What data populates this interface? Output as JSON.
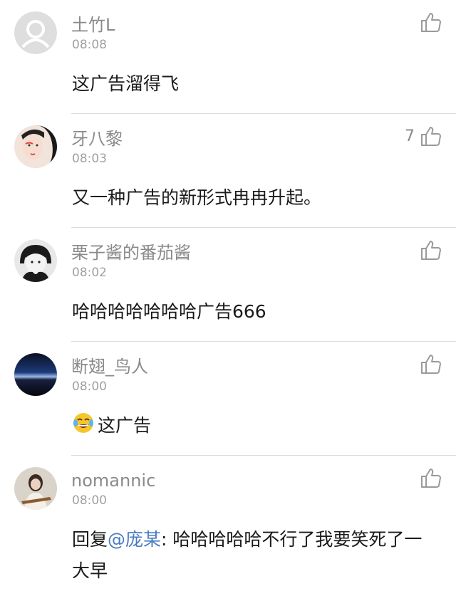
{
  "comments": [
    {
      "username": "土竹L",
      "time": "08:08",
      "text": "这广告溜得飞",
      "likes": "",
      "avatar_icon": "default-avatar-icon"
    },
    {
      "username": "牙八黎",
      "time": "08:03",
      "text": "又一种广告的新形式冉冉升起。",
      "likes": "7",
      "avatar_icon": "user-photo-avatar"
    },
    {
      "username": "栗子酱的番茄酱",
      "time": "08:02",
      "text": "哈哈哈哈哈哈哈广告666",
      "likes": "",
      "avatar_icon": "user-photo-avatar"
    },
    {
      "username": "断翅_鸟人",
      "time": "08:00",
      "text": "这广告",
      "emoji": "laughing-crying-emoji",
      "likes": "",
      "avatar_icon": "user-photo-avatar"
    },
    {
      "username": "nomannic",
      "time": "08:00",
      "reply_prefix": "回复",
      "mention": "@庞某",
      "text": ": 哈哈哈哈哈不行了我要笑死了一大早",
      "likes": "",
      "avatar_icon": "user-photo-avatar"
    }
  ]
}
